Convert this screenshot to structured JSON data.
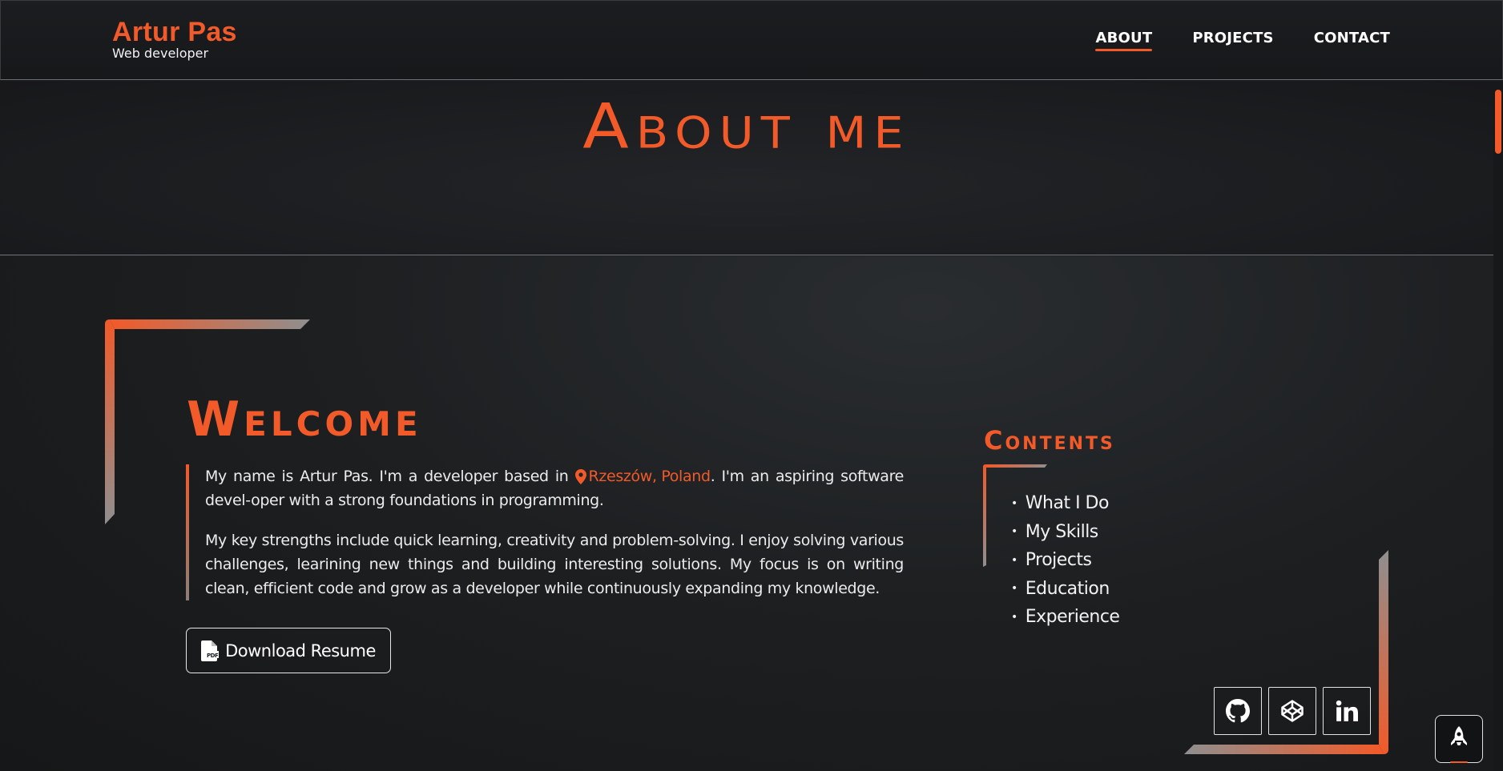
{
  "header": {
    "brand_name": "Artur Pas",
    "brand_role": "Web developer",
    "nav": [
      {
        "label": "ABOUT",
        "active": true
      },
      {
        "label": "PROJECTS",
        "active": false
      },
      {
        "label": "CONTACT",
        "active": false
      }
    ]
  },
  "hero": {
    "title": "About me"
  },
  "welcome": {
    "title": "Welcome",
    "intro_before": "My name is Artur Pas. I'm a developer based in",
    "location": "Rzeszów, Poland",
    "intro_after": ". I'm an aspiring software devel-oper with a strong foundations in programming.",
    "paragraph2": "My key strengths include quick learning, creativity and problem-solving. I enjoy solving various challenges, learining new things and building interesting solutions. My focus is on writing clean, efficient code and grow as a developer while continuously expanding my knowledge.",
    "resume_button": "Download Resume"
  },
  "contents": {
    "title": "Contents",
    "items": [
      "What I Do",
      "My Skills",
      "Projects",
      "Education",
      "Experience"
    ]
  },
  "socials": {
    "icons": [
      "github-icon",
      "codepen-icon",
      "linkedin-icon"
    ]
  },
  "to_top": {
    "icon": "rocket-icon"
  },
  "colors": {
    "accent": "#f25a29",
    "background": "#1d1f21",
    "text": "#f2f2f2"
  }
}
